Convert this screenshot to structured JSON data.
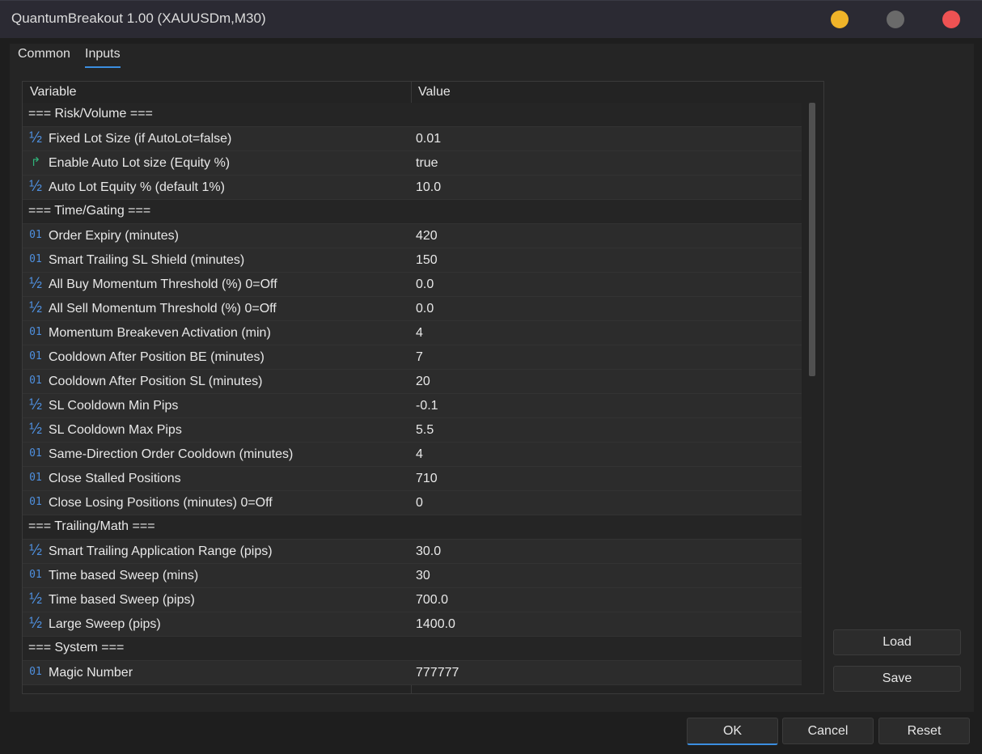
{
  "window": {
    "title": "QuantumBreakout 1.00 (XAUUSDm,M30)",
    "controls": {
      "minimize_color": "#f0b429",
      "maximize_color": "#6a6a6a",
      "close_color": "#ee5253"
    }
  },
  "tabs": [
    {
      "label": "Common",
      "active": false
    },
    {
      "label": "Inputs",
      "active": true
    }
  ],
  "grid": {
    "headers": {
      "variable": "Variable",
      "value": "Value"
    },
    "rows": [
      {
        "type": "section",
        "label": "=== Risk/Volume ==="
      },
      {
        "type": "param",
        "icon": "double",
        "icon_glyph": "½",
        "label": "Fixed Lot Size (if AutoLot=false)",
        "value": "0.01"
      },
      {
        "type": "param",
        "icon": "bool",
        "icon_glyph": "↱",
        "label": "Enable Auto Lot size (Equity %)",
        "value": "true"
      },
      {
        "type": "param",
        "icon": "double",
        "icon_glyph": "½",
        "label": "Auto Lot Equity % (default 1%)",
        "value": "10.0"
      },
      {
        "type": "section",
        "label": "=== Time/Gating ==="
      },
      {
        "type": "param",
        "icon": "int",
        "icon_glyph": "01",
        "label": "Order Expiry (minutes)",
        "value": "420"
      },
      {
        "type": "param",
        "icon": "int",
        "icon_glyph": "01",
        "label": "Smart Trailing SL Shield (minutes)",
        "value": "150"
      },
      {
        "type": "param",
        "icon": "double",
        "icon_glyph": "½",
        "label": "All Buy Momentum Threshold (%) 0=Off",
        "value": "0.0"
      },
      {
        "type": "param",
        "icon": "double",
        "icon_glyph": "½",
        "label": "All Sell Momentum Threshold (%) 0=Off",
        "value": "0.0"
      },
      {
        "type": "param",
        "icon": "int",
        "icon_glyph": "01",
        "label": "Momentum Breakeven Activation (min)",
        "value": "4"
      },
      {
        "type": "param",
        "icon": "int",
        "icon_glyph": "01",
        "label": "Cooldown After Position BE (minutes)",
        "value": "7"
      },
      {
        "type": "param",
        "icon": "int",
        "icon_glyph": "01",
        "label": "Cooldown After Position SL (minutes)",
        "value": "20"
      },
      {
        "type": "param",
        "icon": "double",
        "icon_glyph": "½",
        "label": "SL Cooldown Min Pips",
        "value": "-0.1"
      },
      {
        "type": "param",
        "icon": "double",
        "icon_glyph": "½",
        "label": "SL Cooldown Max Pips",
        "value": "5.5"
      },
      {
        "type": "param",
        "icon": "int",
        "icon_glyph": "01",
        "label": "Same-Direction Order Cooldown (minutes)",
        "value": "4"
      },
      {
        "type": "param",
        "icon": "int",
        "icon_glyph": "01",
        "label": "Close Stalled Positions",
        "value": "710"
      },
      {
        "type": "param",
        "icon": "int",
        "icon_glyph": "01",
        "label": "Close Losing Positions (minutes) 0=Off",
        "value": "0"
      },
      {
        "type": "section",
        "label": "=== Trailing/Math ==="
      },
      {
        "type": "param",
        "icon": "double",
        "icon_glyph": "½",
        "label": "Smart Trailing Application Range (pips)",
        "value": "30.0"
      },
      {
        "type": "param",
        "icon": "int",
        "icon_glyph": "01",
        "label": "Time based Sweep (mins)",
        "value": "30"
      },
      {
        "type": "param",
        "icon": "double",
        "icon_glyph": "½",
        "label": "Time based Sweep (pips)",
        "value": "700.0"
      },
      {
        "type": "param",
        "icon": "double",
        "icon_glyph": "½",
        "label": "Large Sweep (pips)",
        "value": "1400.0"
      },
      {
        "type": "section",
        "label": "=== System ==="
      },
      {
        "type": "param",
        "icon": "int",
        "icon_glyph": "01",
        "label": "Magic Number",
        "value": "777777"
      }
    ]
  },
  "side_buttons": {
    "load": "Load",
    "save": "Save"
  },
  "footer_buttons": {
    "ok": "OK",
    "cancel": "Cancel",
    "reset": "Reset"
  },
  "colors": {
    "accent": "#3b8ee0",
    "icon_blue": "#4e8fde",
    "bool_green": "#2fb47a"
  }
}
